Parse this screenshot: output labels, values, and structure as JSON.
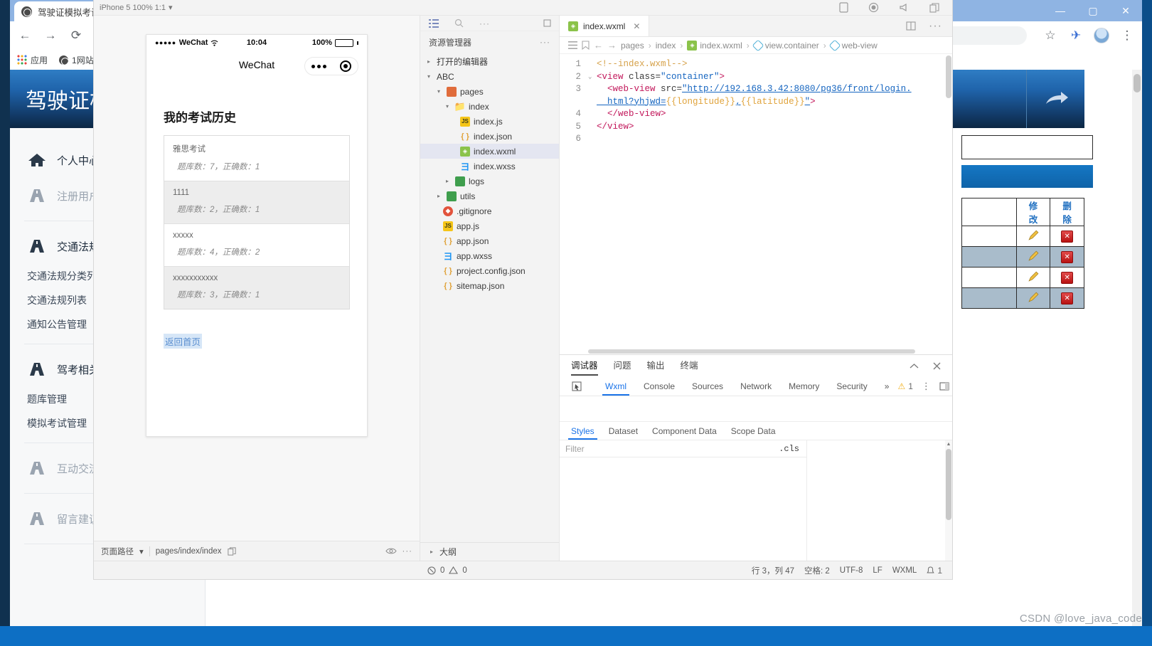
{
  "background_browser": {
    "tab_title": "驾驶证模拟考试",
    "nav": {
      "back": "←",
      "forward": "→",
      "reload": "⟳",
      "info": "ⓘ"
    },
    "omnibox_value": "",
    "bookmarks": [
      {
        "label": "应用",
        "icon": "apps-grid-icon"
      },
      {
        "label": "1网站",
        "icon": "globe-icon"
      }
    ],
    "window_controls": {
      "minimize": "—",
      "maximize": "▢",
      "close": "✕"
    },
    "toolbar_right": {
      "star": "☆",
      "extension": "✈",
      "menu": "⋮"
    },
    "site": {
      "header_title": "驾驶证模拟考试",
      "header_action_icon": "share-arrow-icon",
      "sidebar": [
        {
          "icon": "home-icon",
          "label": "个人中心",
          "dim": false,
          "children": []
        },
        {
          "icon": "road-icon",
          "label": "注册用户管理",
          "dim": true,
          "children": []
        },
        {
          "icon": "road-icon",
          "label": "交通法规管理",
          "dim": false,
          "children": [
            "交通法规分类列表",
            "交通法规列表",
            "通知公告管理"
          ]
        },
        {
          "icon": "road-icon",
          "label": "驾考相关内容",
          "dim": false,
          "children": [
            "题库管理",
            "模拟考试管理"
          ]
        },
        {
          "icon": "road-icon",
          "label": "互动交流管理",
          "dim": true,
          "children": []
        },
        {
          "icon": "road-icon",
          "label": "留言建议管理",
          "dim": true,
          "children": []
        }
      ],
      "table": {
        "headers": [
          "",
          "修改",
          "删除"
        ],
        "rows": [
          {
            "alt": false,
            "edit_icon": "pencil-icon",
            "delete_icon": "delete-icon"
          },
          {
            "alt": true,
            "edit_icon": "pencil-icon",
            "delete_icon": "delete-icon"
          },
          {
            "alt": false,
            "edit_icon": "pencil-icon",
            "delete_icon": "delete-icon"
          },
          {
            "alt": true,
            "edit_icon": "pencil-icon",
            "delete_icon": "delete-icon"
          }
        ]
      }
    }
  },
  "watermark": "CSDN @love_java_code",
  "devtools": {
    "toolbar": {
      "simulator_select": "iPhone 5 100% 1:1",
      "chevron": "▾",
      "icons": [
        "phone-icon",
        "record-icon",
        "megaphone-icon",
        "copy-icon"
      ]
    },
    "simulator": {
      "status_bar": {
        "signal_dots": "●●●●●",
        "carrier": "WeChat",
        "wifi_icon": "wifi-icon",
        "time": "10:04",
        "battery_percent": "100%"
      },
      "navbar": {
        "title": "WeChat",
        "capsule_more": "•••",
        "capsule_target": "target-icon"
      },
      "page": {
        "title": "我的考试历史",
        "items": [
          {
            "name": "雅思考试",
            "meta": "题库数：7，正确数：1",
            "shaded": false
          },
          {
            "name": "1111",
            "meta": "题库数：2，正确数：1",
            "shaded": true
          },
          {
            "name": "xxxxx",
            "meta": "题库数：4，正确数：2",
            "shaded": false
          },
          {
            "name": "xxxxxxxxxxx",
            "meta": "题库数：3，正确数：1",
            "shaded": true
          }
        ],
        "back_link": "返回首页"
      },
      "footer": {
        "path_label": "页面路径",
        "chevron": "▾",
        "path_value": "pages/index/index",
        "copy_icon": "copy-icon",
        "eye_icon": "eye-icon",
        "more_icon": "more-icon"
      }
    },
    "explorer": {
      "activity_icons": [
        "list-icon",
        "search-icon",
        "more-icon",
        "open-editors-icon"
      ],
      "title": "资源管理器",
      "title_more": "···",
      "open_editors_label": "打开的编辑器",
      "project_name": "ABC",
      "tree": [
        {
          "depth": 1,
          "label": "pages",
          "type": "folder",
          "twisty": "▾",
          "selected": false
        },
        {
          "depth": 2,
          "label": "index",
          "type": "folder2",
          "twisty": "▾",
          "selected": false
        },
        {
          "depth": 3,
          "label": "index.js",
          "type": "js",
          "twisty": "",
          "selected": false
        },
        {
          "depth": 3,
          "label": "index.json",
          "type": "json",
          "twisty": "",
          "selected": false
        },
        {
          "depth": 3,
          "label": "index.wxml",
          "type": "wxml",
          "twisty": "",
          "selected": true
        },
        {
          "depth": 3,
          "label": "index.wxss",
          "type": "wxss",
          "twisty": "",
          "selected": false
        },
        {
          "depth": 2,
          "label": "logs",
          "type": "folder",
          "twisty": "▸",
          "selected": false
        },
        {
          "depth": 1,
          "label": "utils",
          "type": "folder",
          "twisty": "▸",
          "selected": false
        },
        {
          "depth": 1,
          "label": ".gitignore",
          "type": "git",
          "twisty": "",
          "selected": false
        },
        {
          "depth": 1,
          "label": "app.js",
          "type": "js",
          "twisty": "",
          "selected": false
        },
        {
          "depth": 1,
          "label": "app.json",
          "type": "json",
          "twisty": "",
          "selected": false
        },
        {
          "depth": 1,
          "label": "app.wxss",
          "type": "wxss",
          "twisty": "",
          "selected": false
        },
        {
          "depth": 1,
          "label": "project.config.json",
          "type": "json",
          "twisty": "",
          "selected": false
        },
        {
          "depth": 1,
          "label": "sitemap.json",
          "type": "json",
          "twisty": "",
          "selected": false
        }
      ],
      "outline_label": "大纲",
      "outline_twisty": "▸"
    },
    "editor": {
      "tab": {
        "label": "index.wxml",
        "close": "✕",
        "icon": "wxml-icon"
      },
      "tab_right_icon": "split-editor-icon",
      "gutter_icons": [
        "outline-icon",
        "bookmark-icon"
      ],
      "nav_back": "←",
      "nav_forward": "→",
      "breadcrumbs": [
        "pages",
        "index",
        "index.wxml",
        "view.container",
        "web-view"
      ],
      "breadcrumb_sep": "›",
      "code": {
        "lines": [
          {
            "no": "1",
            "fold": "",
            "segments": [
              {
                "cls": "c-comment",
                "text": "<!--index.wxml-->"
              }
            ]
          },
          {
            "no": "2",
            "fold": "⌄",
            "segments": [
              {
                "cls": "c-tag",
                "text": "<view "
              },
              {
                "cls": "c-attr",
                "text": "class="
              },
              {
                "cls": "c-str",
                "text": "\"container\""
              },
              {
                "cls": "c-tag",
                "text": ">"
              }
            ]
          },
          {
            "no": "3",
            "fold": "",
            "segments": [
              {
                "cls": "c-tag",
                "text": "  <web-view "
              },
              {
                "cls": "c-attr",
                "text": "src="
              },
              {
                "cls": "c-str",
                "text": "\"http://192.168.3.42:8080/pg36/front/login."
              }
            ]
          },
          {
            "no": "",
            "fold": "",
            "segments": [
              {
                "cls": "c-str",
                "text": "  html?yhjwd="
              },
              {
                "cls": "c-mus",
                "text": "{{longitude}}"
              },
              {
                "cls": "c-str",
                "text": ","
              },
              {
                "cls": "c-mus",
                "text": "{{latitude}}"
              },
              {
                "cls": "c-str",
                "text": "\""
              },
              {
                "cls": "c-tag",
                "text": ">"
              }
            ]
          },
          {
            "no": "4",
            "fold": "",
            "segments": [
              {
                "cls": "c-tag",
                "text": "  </web-view>"
              }
            ]
          },
          {
            "no": "5",
            "fold": "",
            "segments": [
              {
                "cls": "c-tag",
                "text": "</view>"
              }
            ]
          },
          {
            "no": "6",
            "fold": "",
            "segments": [
              {
                "cls": "c-punc",
                "text": ""
              }
            ]
          }
        ]
      }
    },
    "debugger": {
      "panel_tabs": [
        {
          "label": "调试器",
          "active": true
        },
        {
          "label": "问题",
          "active": false
        },
        {
          "label": "输出",
          "active": false
        },
        {
          "label": "终端",
          "active": false
        }
      ],
      "collapse_icon": "chevron-up-icon",
      "close_icon": "close-icon",
      "devtool_tabs": [
        {
          "label": "Wxml",
          "active": true
        },
        {
          "label": "Console",
          "active": false
        },
        {
          "label": "Sources",
          "active": false
        },
        {
          "label": "Network",
          "active": false
        },
        {
          "label": "Memory",
          "active": false
        },
        {
          "label": "Security",
          "active": false
        }
      ],
      "overflow": "»",
      "inspect_icon": "inspect-icon",
      "warning_count": "1",
      "warning_icon": "warning-triangle-icon",
      "menu_icon": "kebab-menu-icon",
      "dock_icon": "dock-icon",
      "styles_tabs": [
        {
          "label": "Styles",
          "active": true
        },
        {
          "label": "Dataset",
          "active": false
        },
        {
          "label": "Component Data",
          "active": false
        },
        {
          "label": "Scope Data",
          "active": false
        }
      ],
      "filter_placeholder": "Filter",
      "filter_value": "",
      "cls_button": ".cls"
    },
    "status_bar": {
      "error_icon": "error-circle-icon",
      "error_count": "0",
      "warning_icon": "warning-triangle-icon",
      "warning_count": "0",
      "cursor_position": "行 3，列 47",
      "indentation": "空格: 2",
      "encoding": "UTF-8",
      "eol": "LF",
      "language": "WXML",
      "bell_icon": "bell-icon",
      "bell_count": "1"
    }
  }
}
